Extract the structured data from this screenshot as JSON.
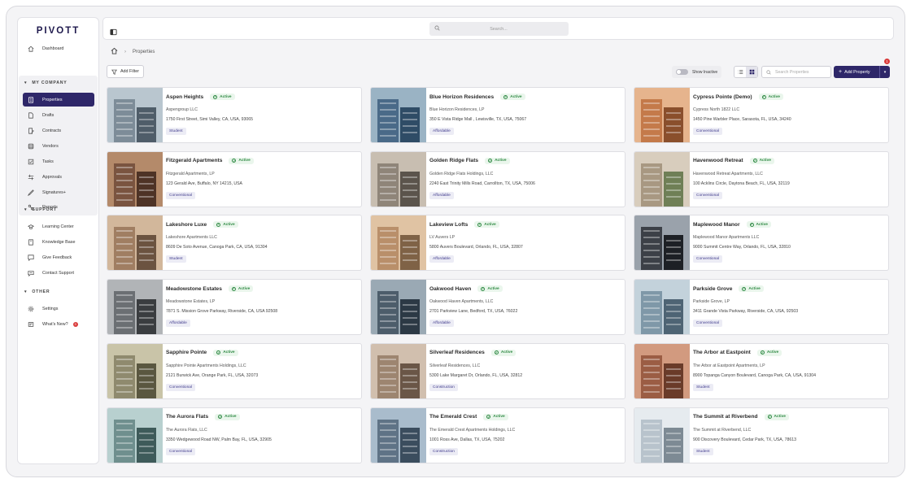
{
  "brand": "PIVOTT",
  "colors": {
    "primary": "#2e2769",
    "active_green": "#2f8a44",
    "alert_red": "#d93a3a"
  },
  "sidebar": {
    "dashboard": "Dashboard",
    "my_company_heading": "MY COMPANY",
    "company_items": [
      {
        "label": "Properties",
        "icon": "building-icon"
      },
      {
        "label": "Drafts",
        "icon": "document-icon"
      },
      {
        "label": "Contracts",
        "icon": "contract-icon"
      },
      {
        "label": "Vendors",
        "icon": "vendors-icon"
      },
      {
        "label": "Tasks",
        "icon": "tasks-icon"
      },
      {
        "label": "Approvals",
        "icon": "approvals-icon"
      },
      {
        "label": "Signatures+",
        "icon": "signature-icon"
      },
      {
        "label": "Reports",
        "icon": "reports-icon"
      }
    ],
    "support_heading": "SUPPORT",
    "support_items": [
      {
        "label": "Learning Center",
        "icon": "graduation-cap-icon"
      },
      {
        "label": "Knowledge Base",
        "icon": "book-icon"
      },
      {
        "label": "Give Feedback",
        "icon": "feedback-icon"
      },
      {
        "label": "Contact Support",
        "icon": "chat-icon"
      }
    ],
    "other_heading": "OTHER",
    "other_items": [
      {
        "label": "Settings",
        "icon": "gear-icon"
      },
      {
        "label": "What's New?",
        "icon": "news-icon",
        "badge": "3"
      }
    ]
  },
  "topbar": {
    "search_placeholder": "Search..."
  },
  "breadcrumb": {
    "current": "Properties"
  },
  "toolbar": {
    "add_filter": "Add Filter",
    "show_inactive": "Show Inactive",
    "search_placeholder": "Search Properties",
    "add_property": "Add Property",
    "notification_count": "1"
  },
  "properties": [
    {
      "name": "Aspen Heights",
      "status": "Active",
      "owner": "Aspengroup LLC",
      "address": "1750 First Street, Simi Valley, CA, USA, 93065",
      "tag": "Student"
    },
    {
      "name": "Blue Horizon Residences",
      "status": "Active",
      "owner": "Blue Horizon Residences, LP",
      "address": "350 E Vista Ridge Mall , Lewisville, TX, USA, 75067",
      "tag": "Affordable"
    },
    {
      "name": "Cypress Pointe (Demo)",
      "status": "Active",
      "owner": "Cypress North 1822 LLC",
      "address": "1450 Pine Warbler Place, Sarasota, FL, USA, 34240",
      "tag": "Conventional"
    },
    {
      "name": "Fitzgerald Apartments",
      "status": "Active",
      "owner": "Fitzgerald Apartments, LP",
      "address": "123 Gerald Ave, Buffalo, NY 14215, USA",
      "tag": "Conventional"
    },
    {
      "name": "Golden Ridge Flats",
      "status": "Active",
      "owner": "Golden Ridge Flats Holdings, LLC",
      "address": "2240 East Trinity Mills Road, Carrollton, TX, USA, 75006",
      "tag": "Affordable"
    },
    {
      "name": "Havenwood Retreat",
      "status": "Active",
      "owner": "Havenwood Retreat Apartments, LLC",
      "address": "100 Acklins Circle, Daytona Beach, FL, USA, 32119",
      "tag": "Conventional"
    },
    {
      "name": "Lakeshore Luxe",
      "status": "Active",
      "owner": "Lakeshore Apartments LLC",
      "address": "8609 De Soto Avenue, Canoga Park, CA, USA, 91304",
      "tag": "Student"
    },
    {
      "name": "Lakeview Lofts",
      "status": "Active",
      "owner": "LV Auvers LP",
      "address": "5800 Auvers Boulevard, Orlando, FL, USA, 32807",
      "tag": "Affordable"
    },
    {
      "name": "Maplewood Manor",
      "status": "Active",
      "owner": "Maplewood Manor Apartments LLC",
      "address": "9000 Summit Centre Way, Orlando, FL, USA, 32810",
      "tag": "Conventional"
    },
    {
      "name": "Meadowstone Estates",
      "status": "Active",
      "owner": "Meadowstone Estates, LP",
      "address": "7871 S. Mission Grove Parkway, Riverside, CA, USA 92508",
      "tag": "Affordable"
    },
    {
      "name": "Oakwood Haven",
      "status": "Active",
      "owner": "Oakwood Haven Apartments, LLC",
      "address": "2701 Parkview Lane, Bedford, TX, USA, 76022",
      "tag": "Affordable"
    },
    {
      "name": "Parkside Grove",
      "status": "Active",
      "owner": "Parkside Grove, LP",
      "address": "3411 Grande Vista Parkway, Riverside, CA, USA, 92503",
      "tag": "Conventional"
    },
    {
      "name": "Sapphire Pointe",
      "status": "Active",
      "owner": "Sapphire Pointe Apartments Holdings, LLC",
      "address": "2121 Burwick Ave, Orange Park, FL, USA, 32073",
      "tag": "Conventional"
    },
    {
      "name": "Silverleaf Residences",
      "status": "Active",
      "owner": "Silverleaf Residences, LLC",
      "address": "5300 Lake Margaret Dr, Orlando, FL, USA, 32812",
      "tag": "Construction"
    },
    {
      "name": "The Arbor at Eastpoint",
      "status": "Active",
      "owner": "The Arbor at Eastpoint Apartments, LP",
      "address": "8900 Topanga Canyon Boulevard, Canoga Park, CA, USA, 91304",
      "tag": "Student"
    },
    {
      "name": "The Aurora Flats",
      "status": "Active",
      "owner": "The Aurora Flats, LLC",
      "address": "3350 Wedgewood Road NW, Palm Bay, FL, USA, 32905",
      "tag": "Conventional"
    },
    {
      "name": "The Emerald Crest",
      "status": "Active",
      "owner": "The Emerald Crest Apartments Holdings, LLC",
      "address": "1001 Ross Ave, Dallas, TX, USA, 75202",
      "tag": "Construction"
    },
    {
      "name": "The Summit at Riverbend",
      "status": "Active",
      "owner": "The Summit at Riverbend, LLC",
      "address": "900 Discovery Boulevard, Cedar Park, TX, USA, 78613",
      "tag": "Student"
    }
  ]
}
